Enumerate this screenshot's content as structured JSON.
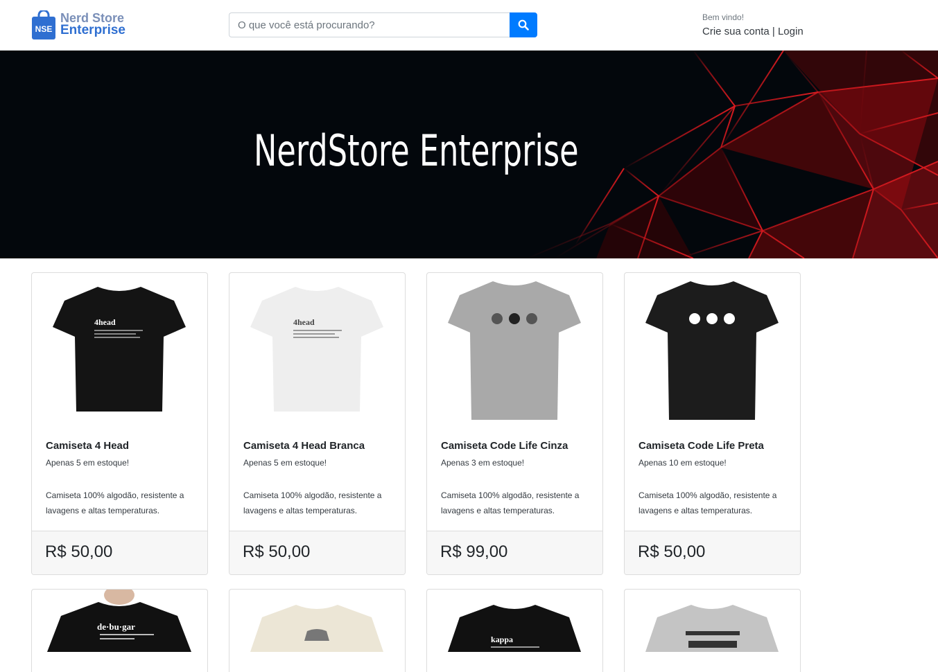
{
  "header": {
    "logo": {
      "badge": "NSE",
      "line1": "Nerd Store",
      "line2": "Enterprise"
    },
    "search": {
      "placeholder": "O que você está procurando?"
    },
    "welcome": {
      "greeting": "Bem vindo!",
      "create_account": "Crie sua conta",
      "separator": " | ",
      "login": "Login"
    }
  },
  "banner": {
    "title": "NerdStore Enterprise"
  },
  "products": [
    {
      "name": "Camiseta 4 Head",
      "stock": "Apenas 5 em estoque!",
      "description": "Camiseta 100% algodão, resistente a lavagens e altas temperaturas.",
      "price": "R$ 50,00",
      "shirt_color": "#141414",
      "print_text": "4head"
    },
    {
      "name": "Camiseta 4 Head Branca",
      "stock": "Apenas 5 em estoque!",
      "description": "Camiseta 100% algodão, resistente a lavagens e altas temperaturas.",
      "price": "R$ 50,00",
      "shirt_color": "#eeeeee",
      "print_text": "4head"
    },
    {
      "name": "Camiseta Code Life Cinza",
      "stock": "Apenas 3 em estoque!",
      "description": "Camiseta 100% algodão, resistente a lavagens e altas temperaturas.",
      "price": "R$ 99,00",
      "shirt_color": "#a9a9a9",
      "print_text": ""
    },
    {
      "name": "Camiseta Code Life Preta",
      "stock": "Apenas 10 em estoque!",
      "description": "Camiseta 100% algodão, resistente a lavagens e altas temperaturas.",
      "price": "R$ 50,00",
      "shirt_color": "#1c1c1c",
      "print_text": ""
    }
  ],
  "products_row2": [
    {
      "shirt_color": "#111111",
      "print_text": "de·bu·gar"
    },
    {
      "shirt_color": "#ece6d6",
      "print_text": ""
    },
    {
      "shirt_color": "#111111",
      "print_text": "kappa"
    },
    {
      "shirt_color": "#c4c4c4",
      "print_text": ""
    }
  ],
  "colors": {
    "primary": "#007bff",
    "banner_bg": "#03070c",
    "banner_lines": "#c8141a"
  }
}
